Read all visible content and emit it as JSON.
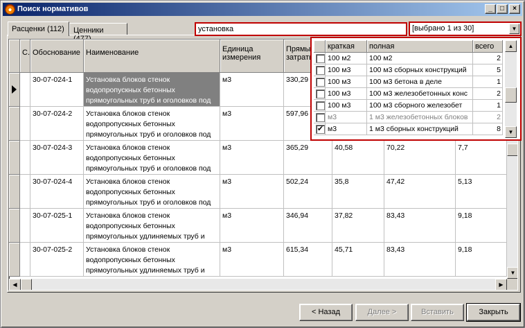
{
  "window": {
    "title": "Поиск нормативов",
    "controls": [
      "_",
      "□",
      "×"
    ]
  },
  "tabs": [
    {
      "label": "Расценки (112)",
      "active": true
    },
    {
      "label": "Ценники (477)",
      "active": false
    }
  ],
  "search": {
    "value": "установка"
  },
  "filter": {
    "value": "[выбрано 1 из 30]"
  },
  "grid": {
    "columns": [
      "С...",
      "Обоснование",
      "Наименование",
      "Единица\nизмерения",
      "Прямые\nзатраты"
    ],
    "rows": [
      {
        "code": "30-07-024-1",
        "name": "Установка блоков стенок водопропускных бетонных прямоугольных труб и оголовков под",
        "unit": "м3",
        "direct": "330,29",
        "c6": "",
        "c7": "",
        "c8": "",
        "selected": true
      },
      {
        "code": "30-07-024-2",
        "name": "Установка блоков стенок водопропускных бетонных прямоугольных труб и оголовков под",
        "unit": "м3",
        "direct": "597,96",
        "c6": "",
        "c7": "",
        "c8": "",
        "selected": false
      },
      {
        "code": "30-07-024-3",
        "name": "Установка блоков стенок водопропускных бетонных прямоугольных труб и оголовков под",
        "unit": "м3",
        "direct": "365,29",
        "c6": "40,58",
        "c7": "70,22",
        "c8": "7,7",
        "selected": false
      },
      {
        "code": "30-07-024-4",
        "name": "Установка блоков стенок водопропускных бетонных прямоугольных труб и оголовков под",
        "unit": "м3",
        "direct": "502,24",
        "c6": "35,8",
        "c7": "47,42",
        "c8": "5,13",
        "selected": false
      },
      {
        "code": "30-07-025-1",
        "name": "Установка блоков стенок водопропускных бетонных прямоугольных удлиняемых труб и",
        "unit": "м3",
        "direct": "346,94",
        "c6": "37,82",
        "c7": "83,43",
        "c8": "9,18",
        "selected": false
      },
      {
        "code": "30-07-025-2",
        "name": "Установка блоков стенок водопропускных бетонных прямоугольных удлиняемых труб и",
        "unit": "м3",
        "direct": "615,34",
        "c6": "45,71",
        "c7": "83,43",
        "c8": "9,18",
        "selected": false
      }
    ]
  },
  "dropdown": {
    "columns": [
      "краткая",
      "полная",
      "всего"
    ],
    "rows": [
      {
        "checked": false,
        "short": "100 м2",
        "full": "100 м2",
        "total": "2",
        "dim": false
      },
      {
        "checked": false,
        "short": "100 м3",
        "full": "100 м3 сборных конструкций",
        "total": "5",
        "dim": false
      },
      {
        "checked": false,
        "short": "100 м3",
        "full": "100 м3 бетона в деле",
        "total": "1",
        "dim": false
      },
      {
        "checked": false,
        "short": "100 м3",
        "full": "100 м3 железобетонных конс",
        "total": "2",
        "dim": false
      },
      {
        "checked": false,
        "short": "100 м3",
        "full": "100 м3 сборного железобет",
        "total": "1",
        "dim": false
      },
      {
        "checked": false,
        "short": "м3",
        "full": "1 м3 железобетонных блоков",
        "total": "2",
        "dim": true
      },
      {
        "checked": true,
        "short": "м3",
        "full": "1 м3 сборных конструкций",
        "total": "8",
        "dim": false
      }
    ]
  },
  "buttons": {
    "back": "< Назад",
    "next": "Далее >",
    "insert": "Вставить",
    "close": "Закрыть"
  },
  "colors": {
    "highlight": "#c00000",
    "title_start": "#0a246a",
    "title_end": "#a6caf0"
  }
}
